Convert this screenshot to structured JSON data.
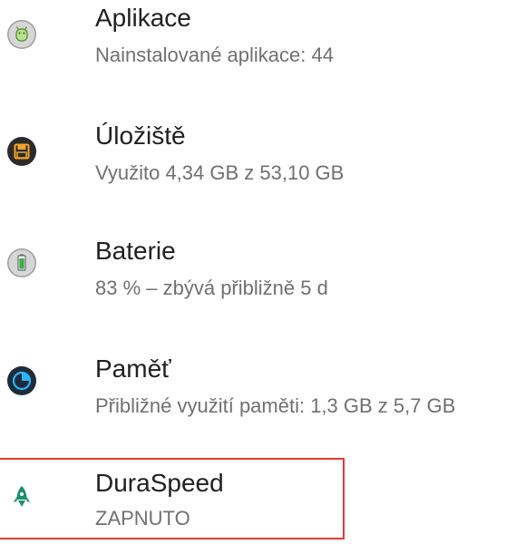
{
  "settings": {
    "items": [
      {
        "title": "Aplikace",
        "summary": "Nainstalované aplikace: 44",
        "icon": "android-apps-icon"
      },
      {
        "title": "Úložiště",
        "summary": "Využito 4,34 GB z 53,10 GB",
        "icon": "storage-icon"
      },
      {
        "title": "Baterie",
        "summary": "83 % – zbývá přibližně 5 d",
        "icon": "battery-icon"
      },
      {
        "title": "Paměť",
        "summary": "Přibližné využití paměti: 1,3 GB z 5,7 GB",
        "icon": "memory-icon"
      },
      {
        "title": "DuraSpeed",
        "summary": "ZAPNUTO",
        "icon": "rocket-icon"
      }
    ]
  },
  "colors": {
    "highlight": "#e53935",
    "title_text": "#212121",
    "summary_text": "#707070",
    "rocket_green": "#1e8f6e"
  }
}
